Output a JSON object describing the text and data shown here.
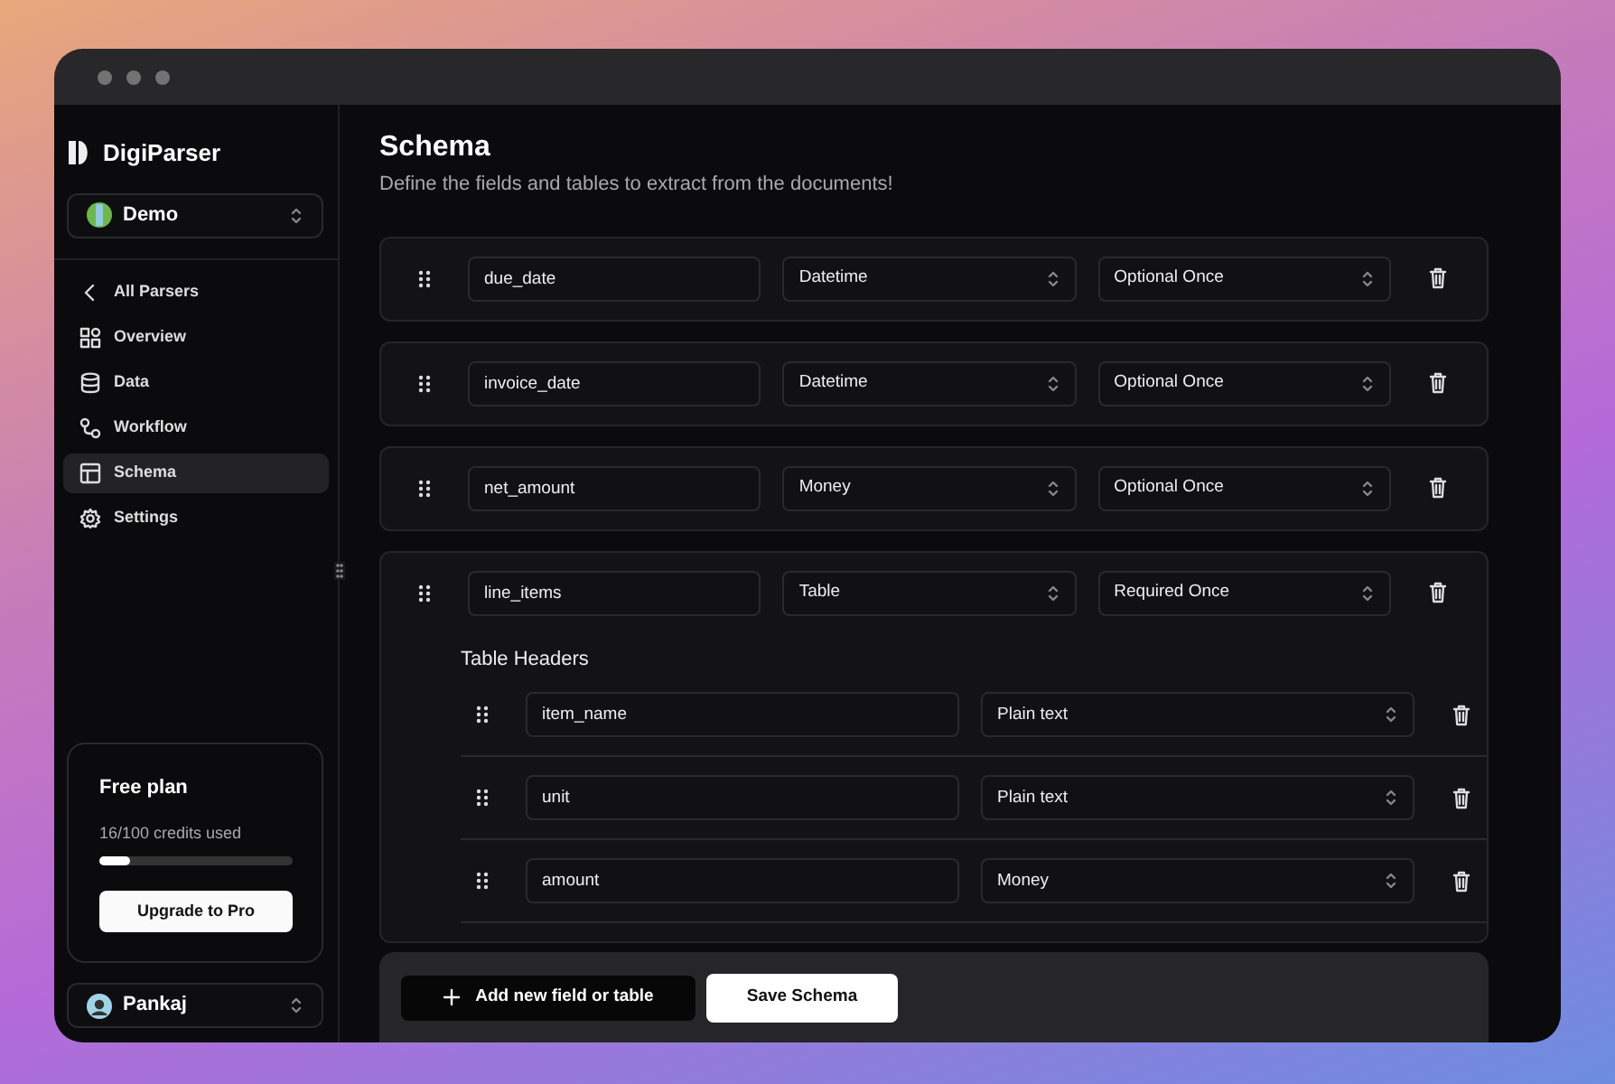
{
  "app": {
    "brand": "DigiParser",
    "workspace": "Demo"
  },
  "sidebar": {
    "back": "All Parsers",
    "items": [
      {
        "label": "Overview",
        "selected": false
      },
      {
        "label": "Data",
        "selected": false
      },
      {
        "label": "Workflow",
        "selected": false
      },
      {
        "label": "Schema",
        "selected": true
      },
      {
        "label": "Settings",
        "selected": false
      }
    ],
    "plan": {
      "title": "Free plan",
      "usage": "16/100 credits used",
      "level": 0.16,
      "button": "Upgrade to Pro"
    },
    "user": "Pankaj"
  },
  "page": {
    "title": "Schema",
    "subtitle": "Define the fields and tables to extract from the documents!"
  },
  "fields": [
    {
      "kind": "field",
      "name": "due_date",
      "type": "Datetime",
      "requirement": "Optional Once"
    },
    {
      "kind": "field",
      "name": "invoice_date",
      "type": "Datetime",
      "requirement": "Optional Once"
    },
    {
      "kind": "field",
      "name": "net_amount",
      "type": "Money",
      "requirement": "Optional Once"
    },
    {
      "kind": "table",
      "name": "line_items",
      "type": "Table",
      "requirement": "Required Once",
      "headers_title": "Table Headers",
      "headers": [
        {
          "name": "item_name",
          "type": "Plain text"
        },
        {
          "name": "unit",
          "type": "Plain text"
        },
        {
          "name": "amount",
          "type": "Money"
        }
      ]
    }
  ],
  "footer": {
    "add_button": "Add new field or table",
    "save_button": "Save Schema"
  }
}
